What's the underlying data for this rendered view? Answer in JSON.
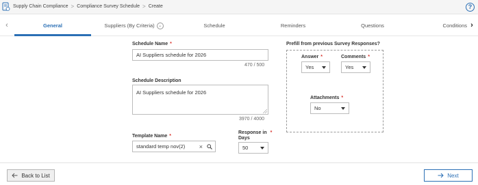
{
  "breadcrumb": {
    "items": [
      "Supply Chain Compliance",
      "Compliance Survey Schedule",
      "Create"
    ],
    "separator": ">"
  },
  "help_label": "?",
  "tabs": [
    {
      "label": "General",
      "active": true
    },
    {
      "label": "Suppliers (By Criteria)",
      "active": false
    },
    {
      "label": "Schedule",
      "active": false
    },
    {
      "label": "Reminders",
      "active": false
    },
    {
      "label": "Questions",
      "active": false
    },
    {
      "label": "Conditions",
      "active": false
    }
  ],
  "form": {
    "schedule_name": {
      "label": "Schedule Name",
      "value": "AI Suppliers schedule for 2026",
      "counter": "470 / 500"
    },
    "schedule_description": {
      "label": "Schedule Description",
      "value": "AI Suppliers schedule for 2026",
      "counter": "3970 / 4000"
    },
    "template_name": {
      "label": "Template Name",
      "value": "standard temp nov(2)"
    },
    "response_days": {
      "label_line1": "Response in",
      "label_line2": "Days",
      "value": "50"
    },
    "required_mark": "*"
  },
  "prefill": {
    "title": "Prefill from previous Survey Responses?",
    "answer": {
      "label": "Answer",
      "value": "Yes"
    },
    "comments": {
      "label": "Comments",
      "value": "Yes"
    },
    "attachments": {
      "label": "Attachments",
      "value": "No"
    }
  },
  "footer": {
    "back_label": "Back to List",
    "next_label": "Next"
  },
  "colors": {
    "accent": "#2a6fb5",
    "required": "#d9322b"
  }
}
